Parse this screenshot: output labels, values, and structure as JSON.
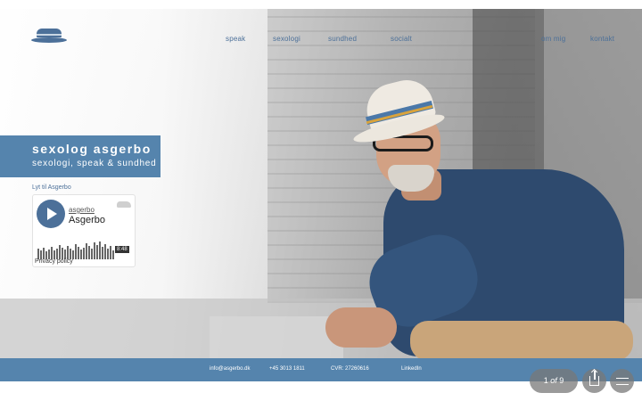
{
  "header": {
    "logo_icon": "hat-icon",
    "nav_left": [
      "speak",
      "sexologi",
      "sundhed",
      "socialt"
    ],
    "nav_right": [
      "om mig",
      "kontakt"
    ]
  },
  "hero": {
    "title": "sexolog asgerbo",
    "subtitle": "sexologi, speak & sundhed",
    "listen_label": "Lyt til Asgerbo"
  },
  "soundcloud": {
    "user": "asgerbo",
    "track": "Asgerbo",
    "duration": "8:48",
    "privacy": "Privacy policy",
    "play_icon": "play-icon",
    "logo_icon": "soundcloud-icon"
  },
  "footer": {
    "email": "info@asgerbo.dk",
    "phone": "+45 3013 1811",
    "cvr": "CVR: 27260616",
    "linkedin": "LinkedIn"
  },
  "gallery": {
    "current": "1",
    "of": "of",
    "total": "9",
    "share_icon": "share-icon",
    "menu_icon": "menu-icon"
  },
  "colors": {
    "brand_blue": "#5584ad",
    "nav_blue": "#4c7099"
  }
}
